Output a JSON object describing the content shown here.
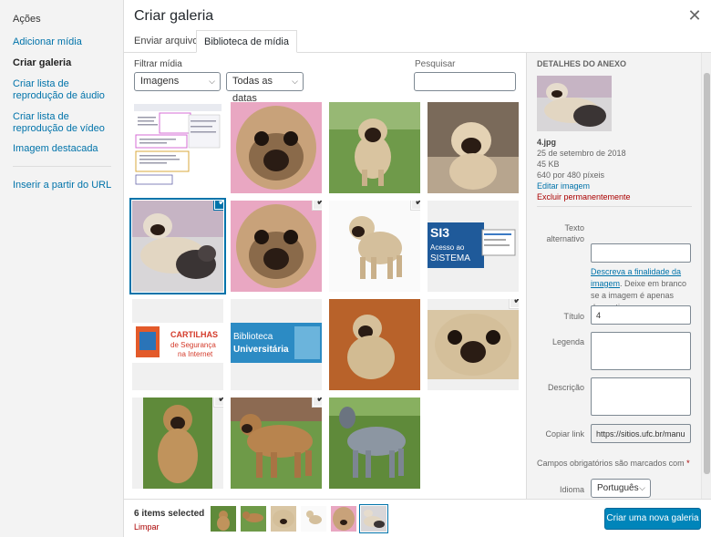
{
  "sidebar": {
    "heading": "Ações",
    "items": [
      {
        "label": "Adicionar mídia"
      },
      {
        "label": "Criar galeria"
      },
      {
        "label": "Criar lista de reprodução de áudio"
      },
      {
        "label": "Criar lista de reprodução de vídeo"
      },
      {
        "label": "Imagem destacada"
      },
      {
        "label": "Inserir a partir do URL"
      }
    ]
  },
  "modal": {
    "title": "Criar galeria",
    "close_icon": "close-icon"
  },
  "tabs": [
    {
      "label": "Enviar arquivos"
    },
    {
      "label": "Biblioteca de mídia"
    }
  ],
  "filters": {
    "label": "Filtrar mídia",
    "type_value": "Imagens",
    "date_value": "Todas as datas",
    "search_label": "Pesquisar",
    "search_value": ""
  },
  "attachments": [
    {
      "kind": "screenshot",
      "selected": false
    },
    {
      "kind": "pug-face",
      "selected": false
    },
    {
      "kind": "pug-grass",
      "selected": false
    },
    {
      "kind": "pug-sit",
      "selected": false
    },
    {
      "kind": "pug-pups",
      "selected": true,
      "current": true
    },
    {
      "kind": "pug-face",
      "selected": true
    },
    {
      "kind": "pug-stand",
      "selected": true
    },
    {
      "kind": "si3",
      "selected": false
    },
    {
      "kind": "cartilhas",
      "selected": false
    },
    {
      "kind": "biblioteca",
      "selected": false
    },
    {
      "kind": "pug-orange",
      "selected": false
    },
    {
      "kind": "pug-close",
      "selected": true
    },
    {
      "kind": "mastiff",
      "selected": true
    },
    {
      "kind": "mastiff2",
      "selected": true
    },
    {
      "kind": "heeler",
      "selected": false
    }
  ],
  "si3_text": {
    "line1": "SI3",
    "line2": "Acesso ao",
    "line3": "SISTEMA"
  },
  "cartilhas_text": {
    "line1": "CARTILHAS",
    "line2": "de Segurança",
    "line3": "na Internet"
  },
  "biblioteca_text": {
    "line1": "Biblioteca",
    "line2": "Universitária"
  },
  "details": {
    "heading": "Detalhes do anexo",
    "filename": "4.jpg",
    "date": "25 de setembro de 2018",
    "size": "45 KB",
    "dimensions": "640 por 480 píxeis",
    "edit_link": "Editar imagem",
    "delete_link": "Excluir permanentemente",
    "alt_label": "Texto alternativo",
    "alt_value": "",
    "alt_note_link": "Descreva a finalidade da imagem",
    "alt_note_rest": ". Deixe em branco se a imagem é apenas decorativa.",
    "title_label": "Título",
    "title_value": "4",
    "caption_label": "Legenda",
    "desc_label": "Descrição",
    "copy_label": "Copiar link",
    "copy_value": "https://sitios.ufc.br/manu",
    "required_note": "Campos obrigatórios são marcados com",
    "required_star": "*",
    "lang_label": "Idioma",
    "lang_value": "Português"
  },
  "footer": {
    "selected_text": "6 items selected",
    "clear_label": "Limpar",
    "button_label": "Criar uma nova galeria"
  },
  "colors": {
    "accent": "#0073aa",
    "button": "#0085ba",
    "danger": "#a00000"
  }
}
